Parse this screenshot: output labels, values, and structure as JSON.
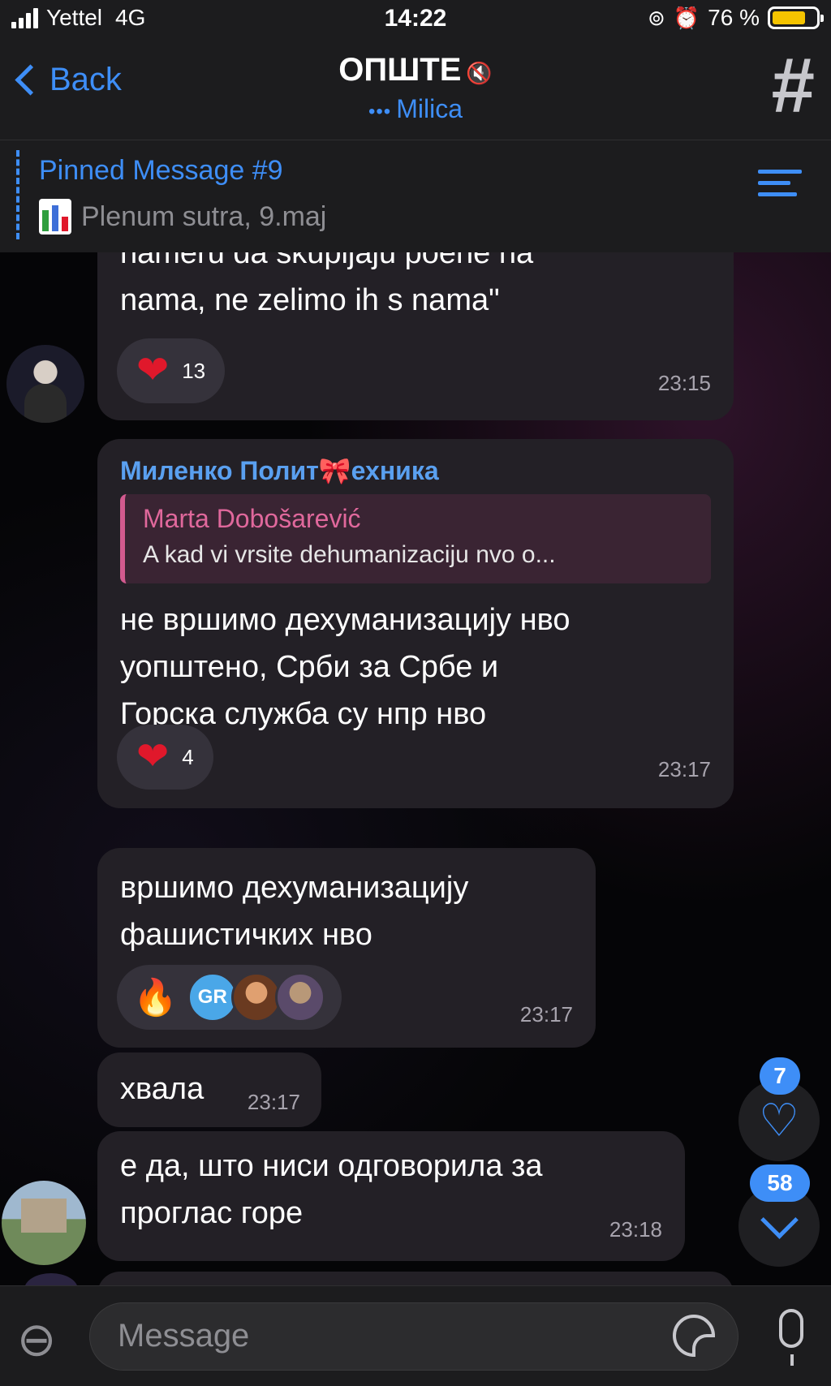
{
  "status_bar": {
    "carrier": "Yettel",
    "network": "4G",
    "time": "14:22",
    "battery_pct": "76 %"
  },
  "nav": {
    "back_label": "Back",
    "title": "ОПШТЕ",
    "typing_dots": "•••",
    "subtitle": "Milica",
    "action_icon": "#"
  },
  "pinned": {
    "title": "Pinned Message #9",
    "text": "Plenum sutra, 9.maj"
  },
  "messages": [
    {
      "lines": [
        "nameru da skupljaju poene na",
        "nama, ne zelimo ih s nama\""
      ],
      "reaction_count": "13",
      "time": "23:15"
    },
    {
      "sender": "Миленко Полит🎀ехника",
      "reply_name": "Marta Dobošarević",
      "reply_text": "A kad vi vrsite dehumanizaciju nvo o...",
      "lines": [
        "не вршимо дехуманизацију нво",
        "уопштено, Срби за Србе и",
        "Горска служба су нпр нво"
      ],
      "reaction_count": "4",
      "time": "23:17"
    },
    {
      "lines": [
        "вршимо дехуманизацију",
        "фашистичких нво"
      ],
      "reaction_avatar": "GR",
      "time": "23:17"
    },
    {
      "text": "хвала",
      "time": "23:17"
    },
    {
      "lines": [
        "е да, што ниси одговорила за",
        "проглас горе"
      ],
      "time": "23:18"
    }
  ],
  "fab": {
    "reactions_badge": "7",
    "unread_badge": "58"
  },
  "composer": {
    "placeholder": "Message"
  },
  "colors": {
    "accent": "#3e8ef7",
    "bubble": "#232026",
    "reply_accent": "#d35a8f",
    "heart": "#e0182b",
    "battery": "#f5c400"
  }
}
